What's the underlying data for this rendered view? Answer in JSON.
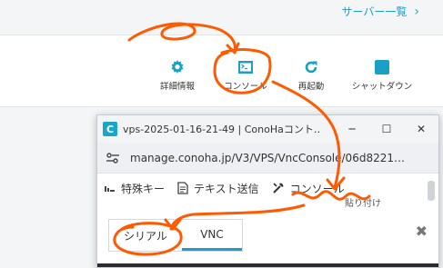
{
  "header": {
    "server_list_link": "サーバー一覧",
    "chevron": "›"
  },
  "toolbar": {
    "detail_label": "詳細情報",
    "console_label": "コンソール",
    "restart_label": "再起動",
    "shutdown_label": "シャットダウン"
  },
  "popup": {
    "app_icon": "C",
    "title": "vps-2025-01-16-21-49 | ConoHaコント…",
    "minimize": "─",
    "maximize": "☐",
    "close": "✕",
    "url": "manage.conoha.jp/V3/VPS/VncConsole/06d8221…",
    "menu": {
      "special_keys": "特殊キー",
      "text_send": "テキスト送信",
      "console": "コンソール",
      "paste_partial": "貼り付け"
    },
    "tabs": [
      {
        "label": "シリアル"
      },
      {
        "label": "VNC"
      }
    ],
    "tab_close": "✖"
  },
  "colors": {
    "accent": "#1aa0c8",
    "annotation": "#ff5a00"
  },
  "icons": [
    "gear-icon",
    "console-icon",
    "restart-icon",
    "shutdown-icon",
    "site-settings-icon",
    "keyboard-icon",
    "document-icon",
    "tools-icon"
  ]
}
